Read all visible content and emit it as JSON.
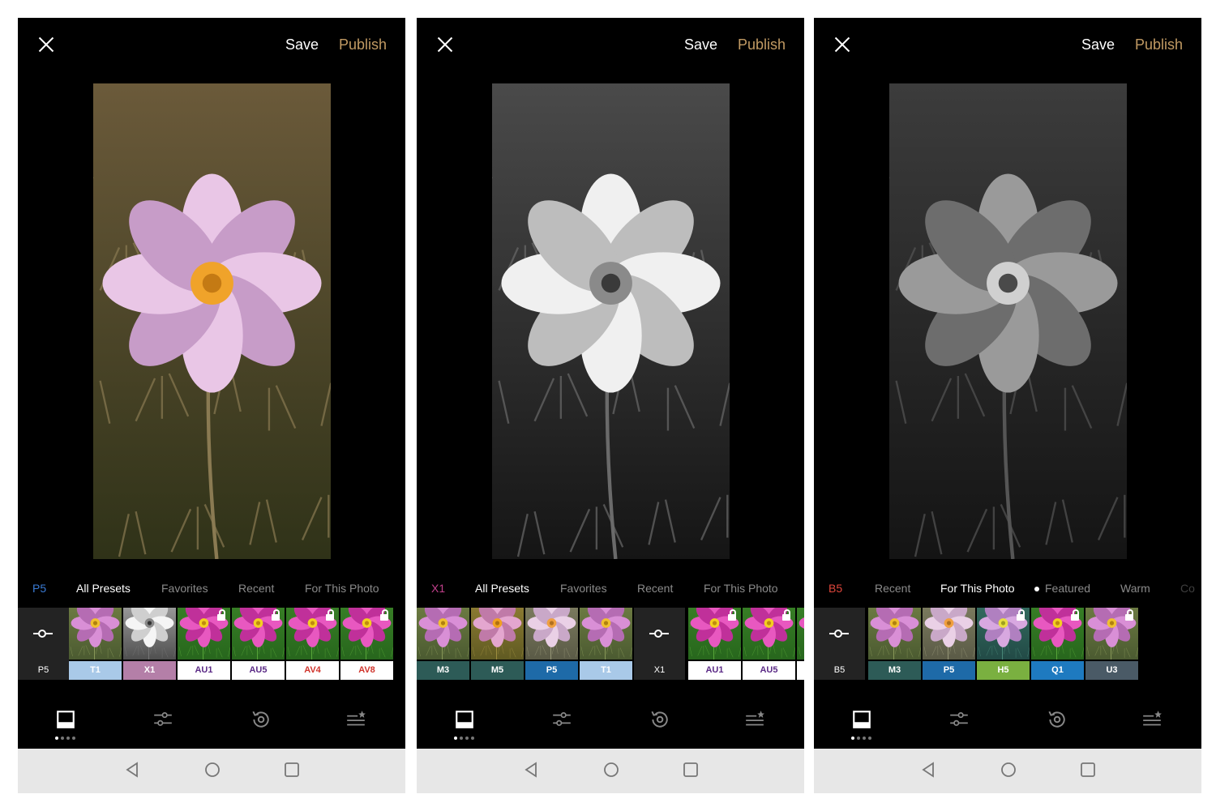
{
  "colors": {
    "publish": "#c19a63",
    "tab_active": "#ffffff",
    "tab_inactive": "#8a8a8a",
    "sysbar": "#e7e7e7",
    "panel_bg": "#000000"
  },
  "panels": [
    {
      "close_icon": "close-icon",
      "save": "Save",
      "publish": "Publish",
      "photo_mode": "color",
      "current_preset": {
        "label": "P5",
        "color": "#3a7bd5"
      },
      "tabs": [
        {
          "label": "All Presets",
          "active": true
        },
        {
          "label": "Favorites",
          "active": false
        },
        {
          "label": "Recent",
          "active": false
        },
        {
          "label": "For This Photo",
          "active": false
        }
      ],
      "slider_tile": {
        "label": "P5",
        "icon": "slider-icon"
      },
      "thumbs": [
        {
          "label": "T1",
          "bg": "#a9c9e8",
          "fg": "#ffffff",
          "tone": "muted",
          "locked": false
        },
        {
          "label": "X1",
          "bg": "#b47fa8",
          "fg": "#ffffff",
          "tone": "bw",
          "locked": false
        },
        {
          "label": "AU1",
          "bg": "#ffffff",
          "fg": "#5b2a86",
          "tone": "vivid",
          "locked": true
        },
        {
          "label": "AU5",
          "bg": "#ffffff",
          "fg": "#5b2a86",
          "tone": "vivid",
          "locked": true
        },
        {
          "label": "AV4",
          "bg": "#ffffff",
          "fg": "#d0342c",
          "tone": "vivid",
          "locked": true
        },
        {
          "label": "AV8",
          "bg": "#ffffff",
          "fg": "#d0342c",
          "tone": "vivid",
          "locked": true
        }
      ],
      "nav": [
        "presets-icon",
        "adjust-icon",
        "history-icon",
        "recipes-icon"
      ]
    },
    {
      "close_icon": "close-icon",
      "save": "Save",
      "publish": "Publish",
      "photo_mode": "bw-high",
      "current_preset": {
        "label": "X1",
        "color": "#c2408c"
      },
      "tabs": [
        {
          "label": "All Presets",
          "active": true
        },
        {
          "label": "Favorites",
          "active": false
        },
        {
          "label": "Recent",
          "active": false
        },
        {
          "label": "For This Photo",
          "active": false
        }
      ],
      "thumbs_before": [
        {
          "label": "M3",
          "bg": "#2d5b57",
          "fg": "#ffffff",
          "tone": "muted",
          "locked": false
        },
        {
          "label": "M5",
          "bg": "#2d5b57",
          "fg": "#ffffff",
          "tone": "warm",
          "locked": false
        },
        {
          "label": "P5",
          "bg": "#1e6aa8",
          "fg": "#ffffff",
          "tone": "faded",
          "locked": false
        },
        {
          "label": "T1",
          "bg": "#a9c9e8",
          "fg": "#ffffff",
          "tone": "muted",
          "locked": false
        }
      ],
      "slider_tile": {
        "label": "X1",
        "icon": "slider-icon"
      },
      "thumbs": [
        {
          "label": "AU1",
          "bg": "#ffffff",
          "fg": "#5b2a86",
          "tone": "vivid",
          "locked": true
        },
        {
          "label": "AU5",
          "bg": "#ffffff",
          "fg": "#5b2a86",
          "tone": "vivid",
          "locked": true
        },
        {
          "label": "A",
          "bg": "#ffffff",
          "fg": "#d0342c",
          "tone": "vivid",
          "locked": false
        }
      ],
      "nav": [
        "presets-icon",
        "adjust-icon",
        "history-icon",
        "recipes-icon"
      ]
    },
    {
      "close_icon": "close-icon",
      "save": "Save",
      "publish": "Publish",
      "photo_mode": "bw-low",
      "current_preset": {
        "label": "B5",
        "color": "#e0463b"
      },
      "tabs": [
        {
          "label": "Recent",
          "active": false
        },
        {
          "label": "For This Photo",
          "active": true
        },
        {
          "label": "Featured",
          "active": false,
          "dot": true
        },
        {
          "label": "Warm",
          "active": false
        },
        {
          "label": "Co",
          "active": false
        }
      ],
      "slider_tile": {
        "label": "B5",
        "icon": "slider-icon"
      },
      "thumbs": [
        {
          "label": "M3",
          "bg": "#2d5b57",
          "fg": "#ffffff",
          "tone": "muted",
          "locked": false
        },
        {
          "label": "P5",
          "bg": "#1e6aa8",
          "fg": "#ffffff",
          "tone": "faded",
          "locked": false
        },
        {
          "label": "H5",
          "bg": "#7ab040",
          "fg": "#ffffff",
          "tone": "cool",
          "locked": true
        },
        {
          "label": "Q1",
          "bg": "#1e7ac0",
          "fg": "#ffffff",
          "tone": "vivid",
          "locked": true
        },
        {
          "label": "U3",
          "bg": "#4a5a66",
          "fg": "#ffffff",
          "tone": "muted",
          "locked": true
        }
      ],
      "nav": [
        "presets-icon",
        "adjust-icon",
        "history-icon",
        "recipes-icon"
      ]
    }
  ],
  "system_nav": [
    "back-icon",
    "home-icon",
    "recents-icon"
  ]
}
